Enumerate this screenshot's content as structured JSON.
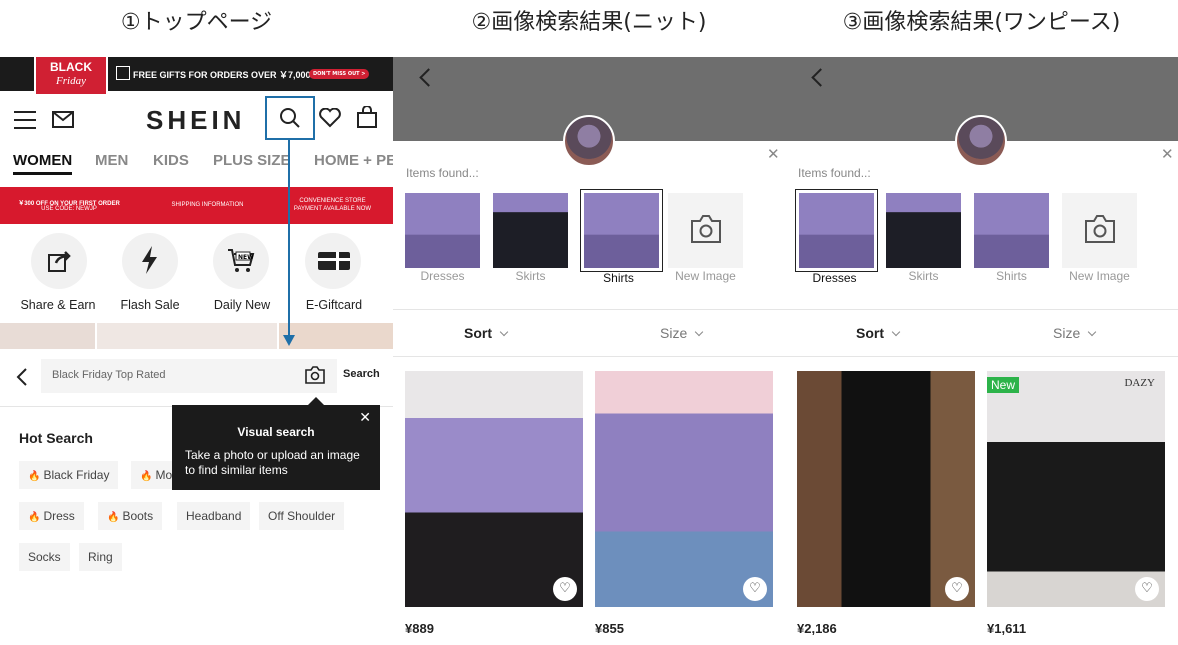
{
  "captions": [
    "①トップページ",
    "②画像検索結果(ニット)",
    "③画像検索結果(ワンピース)"
  ],
  "home": {
    "promo": {
      "badge_line1": "BLACK",
      "badge_line2": "Friday",
      "text": "FREE GIFTS FOR ORDERS OVER ￥7,000",
      "pill": "DON'T MISS OUT >"
    },
    "logo": "SHEIN",
    "nav": [
      "WOMEN",
      "MEN",
      "KIDS",
      "PLUS SIZE",
      "HOME + PE"
    ],
    "banner": [
      "￥300 OFF ON YOUR FIRST ORDER",
      "USE CODE: NEWJP",
      "SHIPPING INFORMATION",
      "CONVENIENCE STORE",
      "PAYMENT AVAILABLE NOW"
    ],
    "shortcuts": [
      "Share & Earn",
      "Flash Sale",
      "Daily New",
      "E-Giftcard"
    ],
    "search": {
      "placeholder": "Black Friday Top Rated",
      "button": "Search"
    },
    "tooltip": {
      "title": "Visual search",
      "body": "Take a photo or upload an image to find similar items"
    },
    "hot_title": "Hot Search",
    "hot_chips": [
      "Black Friday",
      "Mo",
      "Dress",
      "Boots",
      "Headband",
      "Off Shoulder",
      "Socks",
      "Ring"
    ]
  },
  "knit": {
    "found": "Items found..:",
    "thumbs": [
      "Dresses",
      "Skirts",
      "Shirts",
      "New Image"
    ],
    "selected": "Shirts",
    "sort": "Sort",
    "size": "Size",
    "prices": [
      "¥889",
      "¥855"
    ]
  },
  "dress": {
    "found": "Items found..:",
    "thumbs": [
      "Dresses",
      "Skirts",
      "Shirts",
      "New Image"
    ],
    "selected": "Dresses",
    "sort": "Sort",
    "size": "Size",
    "prices": [
      "¥2,186",
      "¥1,611"
    ],
    "new_badge": "New",
    "brand": "DAZY"
  },
  "colors": {
    "accent_blue": "#1f6fa8",
    "shein_red": "#d7192d",
    "knit_purple": "#8f80c0"
  }
}
